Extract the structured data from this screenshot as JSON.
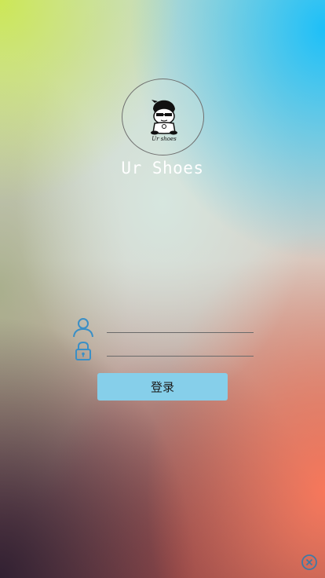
{
  "app": {
    "title": "Ur Shoes",
    "logo_text": "Ur shoes"
  },
  "form": {
    "username": {
      "value": "",
      "placeholder": ""
    },
    "password": {
      "value": "",
      "placeholder": ""
    },
    "login_label": "登录"
  },
  "icons": {
    "username": "user-icon",
    "password": "lock-icon",
    "close": "close-circle-icon"
  },
  "colors": {
    "accent": "#86cfea",
    "icon": "#3a8fc6"
  }
}
